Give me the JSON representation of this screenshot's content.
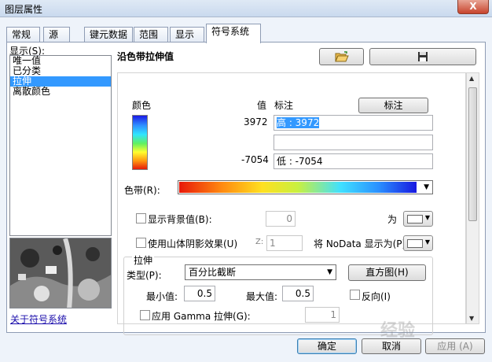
{
  "window": {
    "title": "图层属性",
    "close_label": "X"
  },
  "tabs": [
    {
      "label": "常规",
      "active": false
    },
    {
      "label": "源",
      "active": false
    },
    {
      "label": "键元数据",
      "active": false
    },
    {
      "label": "范围",
      "active": false
    },
    {
      "label": "显示",
      "active": false
    },
    {
      "label": "符号系统",
      "active": true
    }
  ],
  "sidebar": {
    "show_label": "显示(S):",
    "items": [
      {
        "label": "唯一值",
        "selected": false
      },
      {
        "label": "已分类",
        "selected": false
      },
      {
        "label": "拉伸",
        "selected": true
      },
      {
        "label": "离散颜色",
        "selected": false
      }
    ],
    "about_link": "关于符号系统"
  },
  "renderer": {
    "title": "沿色带拉伸值",
    "open_icon": "folder-open-icon",
    "save_icon": "floppy-disk-icon"
  },
  "legend": {
    "color_header": "颜色",
    "value_header": "值",
    "label_header": "标注",
    "label_button": "标注",
    "high_value": "3972",
    "low_value": "-7054",
    "high_label": "高 : 3972",
    "middle_label": "",
    "low_label": "低 : -7054"
  },
  "color_ramp": {
    "label": "色带(R):"
  },
  "background": {
    "checkbox_label": "显示背景值(B):",
    "value": "0",
    "as_label": "为"
  },
  "hillshade": {
    "checkbox_label": "使用山体阴影效果(U)",
    "z_label": "Z:",
    "z_value": "1",
    "nodata_label": "将 NoData 显示为(P)"
  },
  "stretch": {
    "group_label": "拉伸",
    "type_label": "类型(P):",
    "type_value": "百分比截断",
    "histogram_button": "直方图(H)",
    "min_label": "最小值:",
    "min_value": "0.5",
    "max_label": "最大值:",
    "max_value": "0.5",
    "invert_label": "反向(I)",
    "gamma_label": "应用 Gamma 拉伸(G):",
    "gamma_value": "1"
  },
  "footer": {
    "ok": "确定",
    "cancel": "取消",
    "apply": "应用 (A)"
  },
  "watermark": "经验"
}
